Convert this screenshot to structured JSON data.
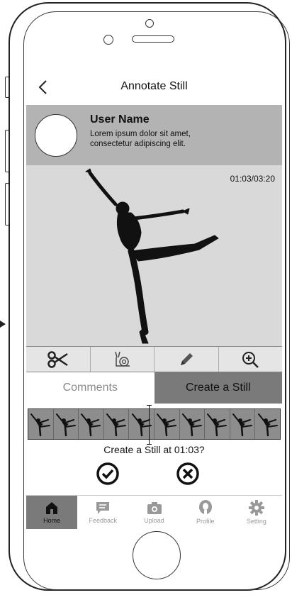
{
  "app": {
    "title": "Annotate Still"
  },
  "user": {
    "name": "User Name",
    "description": "Lorem ipsum dolor sit amet, consectetur adipiscing elit."
  },
  "video": {
    "timestamp": "01:03/03:20"
  },
  "toolbar": {
    "icons": [
      "scissors-icon",
      "snail-icon",
      "pencil-icon",
      "zoom-in-icon"
    ]
  },
  "tabs": [
    {
      "label": "Comments",
      "active": false
    },
    {
      "label": "Create a Still",
      "active": true
    }
  ],
  "filmstrip": {
    "frame_count": 10
  },
  "prompt": {
    "question": "Create a Still at 01:03?"
  },
  "actions": {
    "confirm_icon": "check-circle-icon",
    "cancel_icon": "x-circle-icon"
  },
  "nav": [
    {
      "label": "Home",
      "icon": "home-icon",
      "active": true
    },
    {
      "label": "Feedback",
      "icon": "chat-icon",
      "active": false
    },
    {
      "label": "Upload",
      "icon": "camera-icon",
      "active": false
    },
    {
      "label": "Profile",
      "icon": "profile-icon",
      "active": false
    },
    {
      "label": "Setting",
      "icon": "gear-icon",
      "active": false
    }
  ],
  "colors": {
    "header_gray": "#b3b3b3",
    "video_bg": "#d9d9d9",
    "active_tab": "#7a7a7a",
    "filmstrip_bg": "#8d8d8d"
  }
}
